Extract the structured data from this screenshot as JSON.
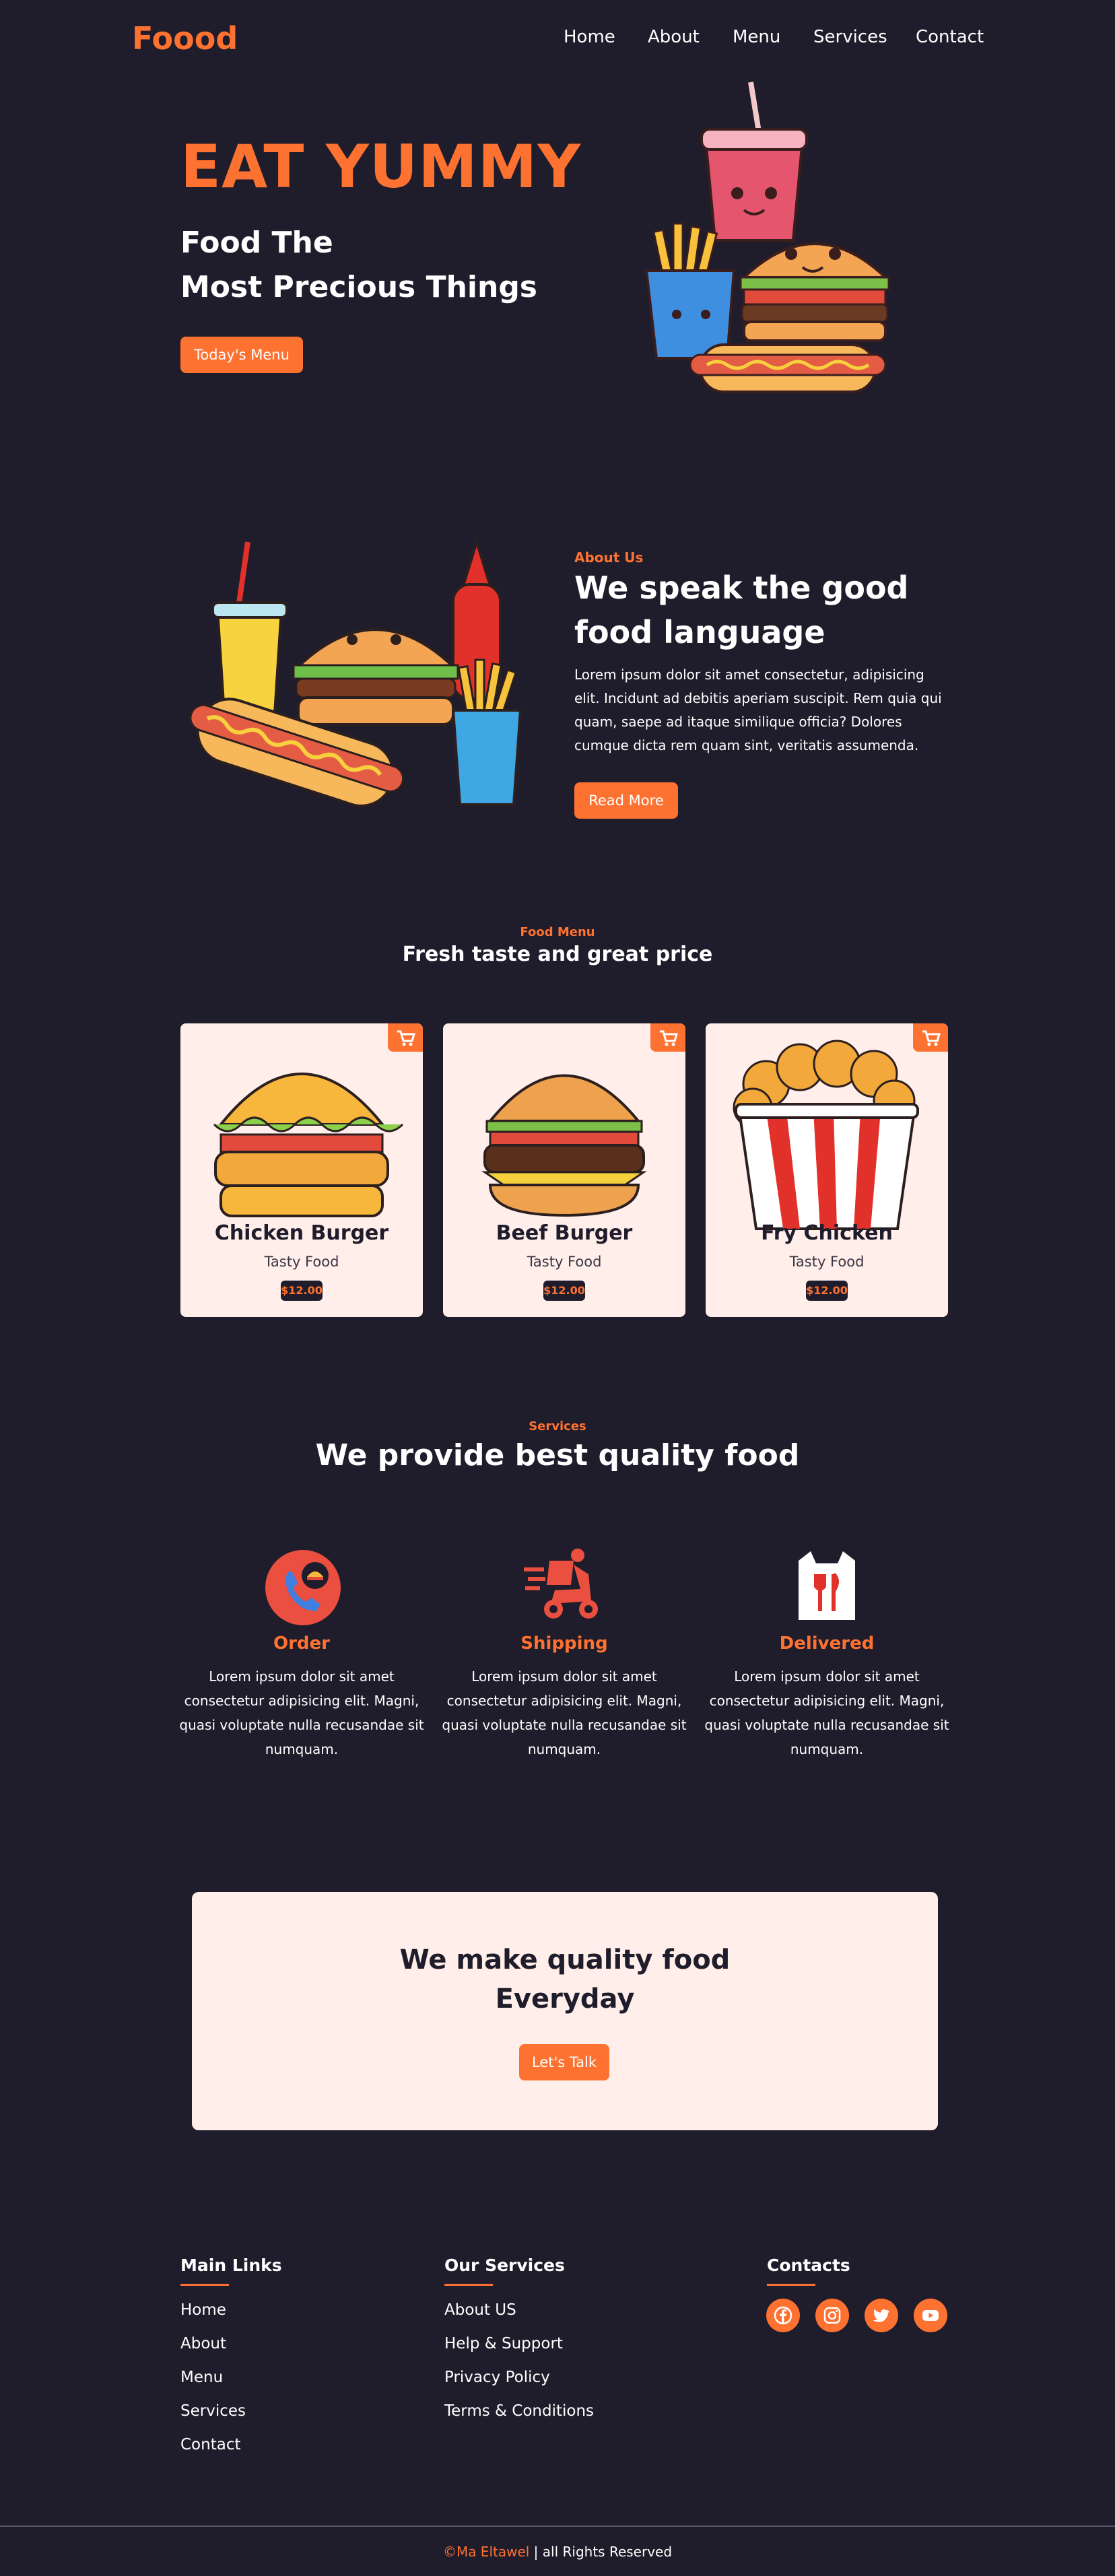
{
  "brand": {
    "logo": "Foood",
    "accent": "#fe7231",
    "background": "#1f1c2b",
    "card_bg": "#ffeee9"
  },
  "nav": {
    "items": [
      "Home",
      "About",
      "Menu",
      "Services",
      "Contact"
    ]
  },
  "hero": {
    "title": "EAT YUMMY",
    "subtitle_line1": "Food The",
    "subtitle_line2": "Most Precious Things",
    "button": "Today's Menu",
    "illustration": "fast-food-characters-illustration"
  },
  "about": {
    "label": "About Us",
    "title_line1": "We speak the good",
    "title_line2": "food language",
    "text": "Lorem ipsum dolor sit amet consectetur, adipisicing elit. Incidunt ad debitis aperiam suscipit. Rem quia qui quam, saepe ad itaque similique officia? Dolores cumque dicta rem quam sint, veritatis assumenda.",
    "button": "Read More",
    "illustration": "burger-hotdog-fries-illustration"
  },
  "menu": {
    "label": "Food Menu",
    "title": "Fresh taste and great price",
    "items": [
      {
        "name": "Chicken Burger",
        "desc": "Tasty Food",
        "price": "$12.00",
        "icon": "chicken-burger-image"
      },
      {
        "name": "Beef Burger",
        "desc": "Tasty Food",
        "price": "$12.00",
        "icon": "beef-burger-image"
      },
      {
        "name": "Fry Chicken",
        "desc": "Tasty Food",
        "price": "$12.00",
        "icon": "fried-chicken-bucket-image"
      }
    ]
  },
  "services": {
    "label": "Services",
    "title": "We provide best quality food",
    "items": [
      {
        "name": "Order",
        "icon": "phone-order-icon",
        "text": "Lorem ipsum dolor sit amet consectetur adipisicing elit. Magni, quasi voluptate nulla recusandae sit numquam."
      },
      {
        "name": "Shipping",
        "icon": "delivery-scooter-icon",
        "text": "Lorem ipsum dolor sit amet consectetur adipisicing elit. Magni, quasi voluptate nulla recusandae sit numquam."
      },
      {
        "name": "Delivered",
        "icon": "takeaway-bag-icon",
        "text": "Lorem ipsum dolor sit amet consectetur adipisicing elit. Magni, quasi voluptate nulla recusandae sit numquam."
      }
    ]
  },
  "cta": {
    "title_line1": "We make quality food",
    "title_line2": "Everyday",
    "button": "Let's Talk"
  },
  "footer": {
    "main_links": {
      "heading": "Main Links",
      "items": [
        "Home",
        "About",
        "Menu",
        "Services",
        "Contact"
      ]
    },
    "services": {
      "heading": "Our Services",
      "items": [
        "About US",
        "Help & Support",
        "Privacy Policy",
        "Terms & Conditions"
      ]
    },
    "contacts": {
      "heading": "Contacts",
      "social": [
        "facebook-icon",
        "instagram-icon",
        "twitter-icon",
        "youtube-icon"
      ]
    },
    "copyright_symbol": "©",
    "author": "Ma Eltawel",
    "rights": " | all Rights Reserved"
  }
}
